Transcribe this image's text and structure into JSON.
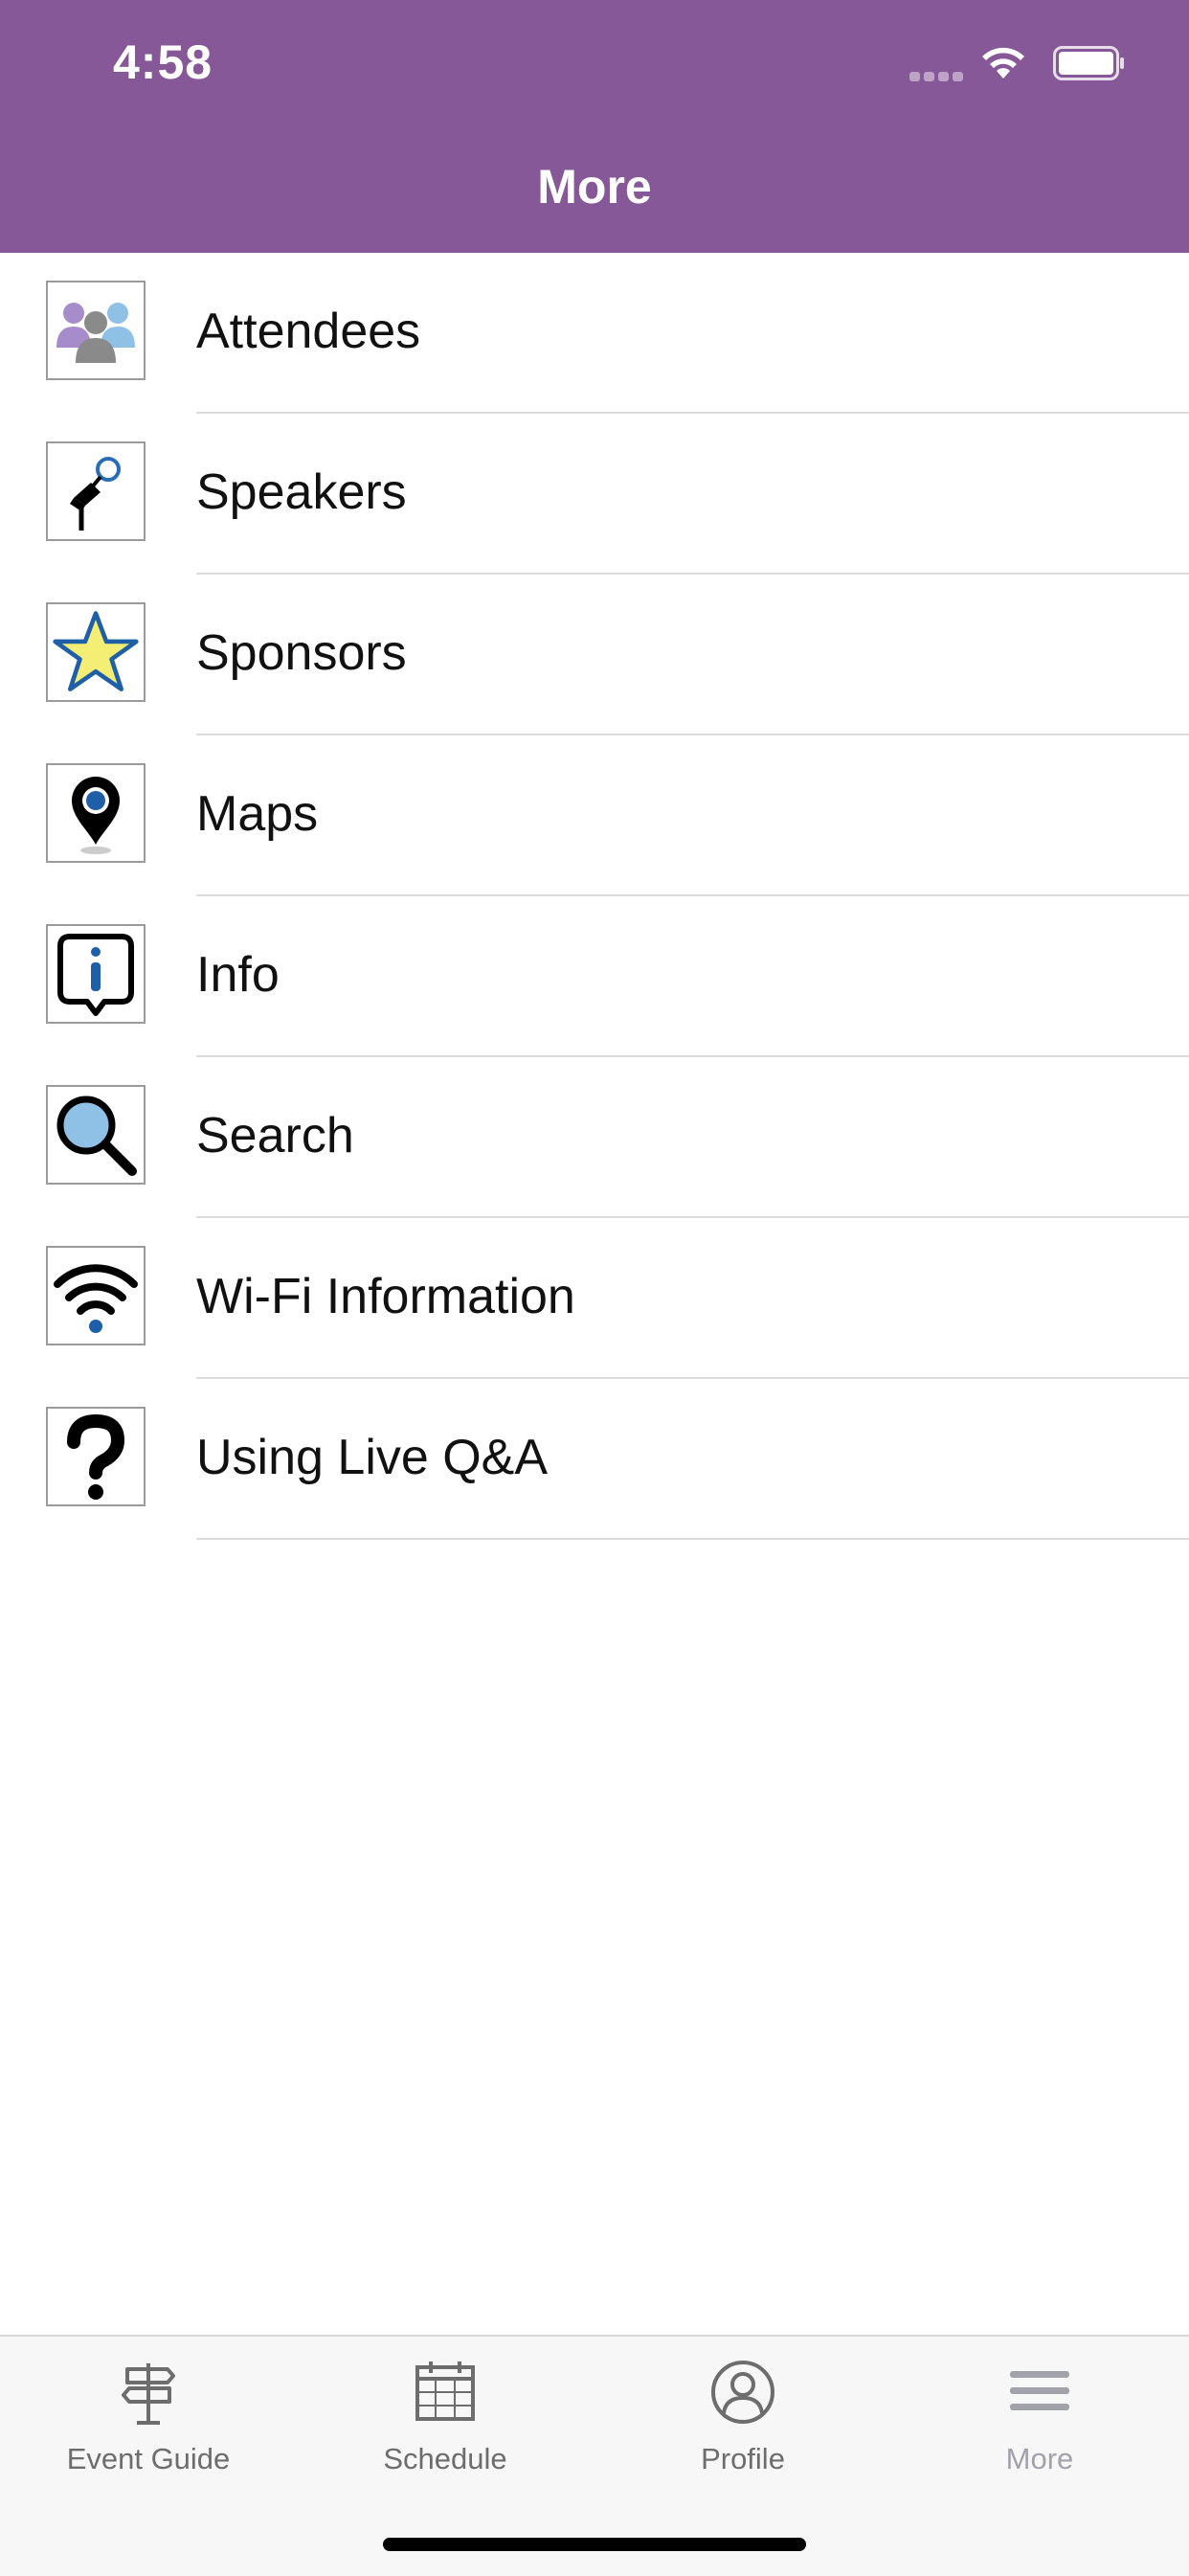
{
  "status_bar": {
    "time": "4:58"
  },
  "nav": {
    "title": "More"
  },
  "colors": {
    "header": "#875897",
    "separator": "#dcdcdc",
    "tab_inactive": "#6d6d6d",
    "tab_more": "#a2a2aa"
  },
  "menu": {
    "items": [
      {
        "label": "Attendees",
        "icon": "attendees-icon"
      },
      {
        "label": "Speakers",
        "icon": "speakers-icon"
      },
      {
        "label": "Sponsors",
        "icon": "star-icon"
      },
      {
        "label": "Maps",
        "icon": "map-pin-icon"
      },
      {
        "label": "Info",
        "icon": "info-icon"
      },
      {
        "label": "Search",
        "icon": "magnifier-icon"
      },
      {
        "label": "Wi-Fi Information",
        "icon": "wifi-icon"
      },
      {
        "label": "Using Live Q&A",
        "icon": "question-icon"
      }
    ]
  },
  "tabbar": {
    "tabs": [
      {
        "label": "Event Guide",
        "icon": "signpost-icon"
      },
      {
        "label": "Schedule",
        "icon": "calendar-icon"
      },
      {
        "label": "Profile",
        "icon": "profile-icon"
      },
      {
        "label": "More",
        "icon": "hamburger-icon"
      }
    ]
  }
}
